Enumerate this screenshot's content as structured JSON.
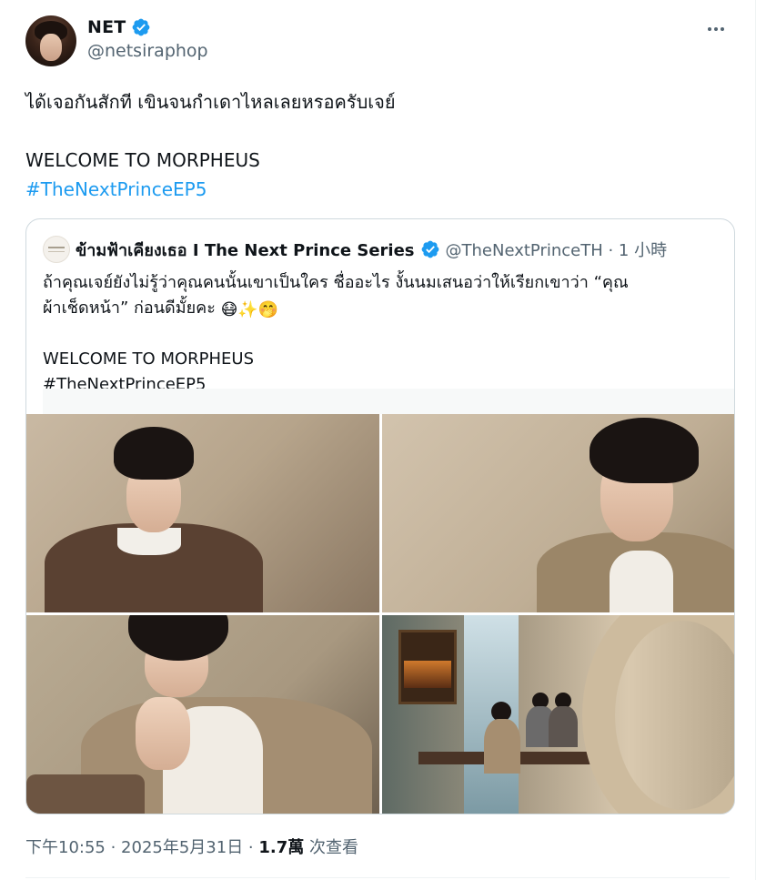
{
  "author": {
    "display_name": "NET",
    "handle": "@netsiraphop",
    "verified_icon": "verified-badge-icon",
    "avatar": "profile-avatar"
  },
  "more_icon": "more-options-icon",
  "tweet": {
    "line1": "ได้เจอกันสักที เขินจนกำเดาไหลเลยหรอครับเจย์",
    "line2": "WELCOME TO MORPHEUS",
    "hashtag": "#TheNextPrinceEP5"
  },
  "quoted": {
    "display_name": "ข้ามฟ้าเคียงเธอ I The Next Prince Series",
    "handle_time": "@TheNextPrinceTH · 1 小時",
    "line1": "ถ้าคุณเจย์ยังไม่รู้ว่าคุณคนนั้นเขาเป็นใคร ชื่ออะไร งั้นนมเสนอว่าให้เรียกเขาว่า “คุณ",
    "line2": "ผ้าเช็ดหน้า” ก่อนดีมั้ยคะ",
    "emojis": [
      "😷",
      "✨",
      "🤭"
    ],
    "line3": "WELCOME TO MORPHEUS",
    "line4": "#TheNextPrinceEP5"
  },
  "meta": {
    "timestamp": "下午10:55 · 2025年5月31日 · ",
    "views_count": "1.7萬",
    "views_label": " 次查看"
  },
  "colors": {
    "accent": "#1d9bf0",
    "text": "#0f1419",
    "secondary": "#536471",
    "border": "#cfd9de"
  }
}
